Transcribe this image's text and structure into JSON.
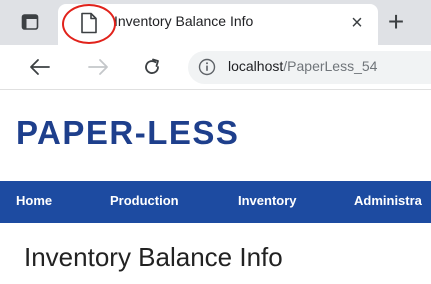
{
  "browser": {
    "tab": {
      "title": "Inventory Balance Info",
      "close_glyph": "×",
      "favicon": "page-icon"
    },
    "new_tab_glyph": "+",
    "address": {
      "host": "localhost",
      "path": "/PaperLess_54"
    }
  },
  "site": {
    "logo": "PAPER-LESS",
    "nav": {
      "items": [
        "Home",
        "Production",
        "Inventory",
        "Administra"
      ]
    },
    "page_title": "Inventory Balance Info"
  },
  "colors": {
    "brand": "#1e3f8c",
    "navbar": "#1d4ba1",
    "annotation": "#e1221b"
  }
}
